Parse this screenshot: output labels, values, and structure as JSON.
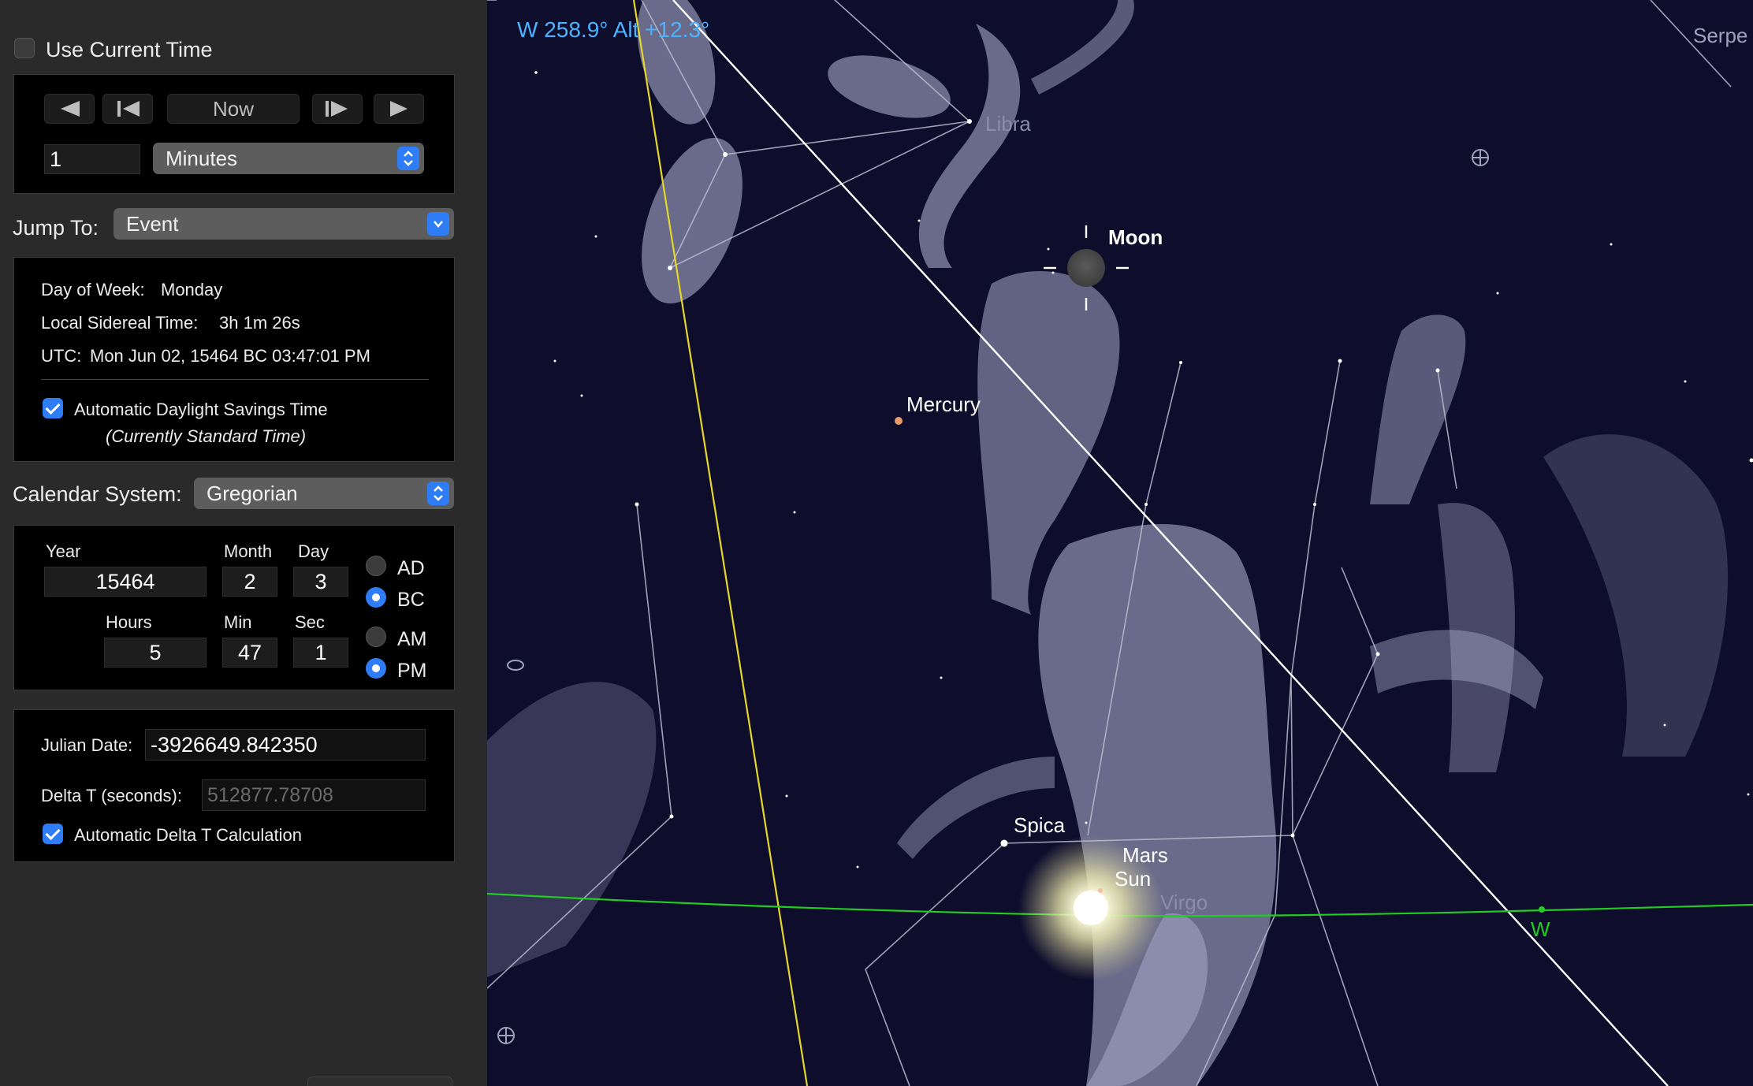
{
  "time_panel": {
    "use_current_time_label": "Use Current Time",
    "use_current_time_checked": false,
    "step_controls": {
      "rewind_icon": "rewind-icon",
      "step_back_icon": "step-back-icon",
      "now_label": "Now",
      "step_forward_icon": "step-forward-icon",
      "play_icon": "play-icon"
    },
    "step_amount": "1",
    "step_unit": "Minutes",
    "jump_to_label": "Jump To:",
    "jump_to_value": "Event"
  },
  "info": {
    "day_of_week_label": "Day of Week:",
    "day_of_week": "Monday",
    "sidereal_label": "Local Sidereal Time:",
    "sidereal_time": "3h 1m 26s",
    "utc_label": "UTC:",
    "utc_value": "Mon Jun 02, 15464 BC 03:47:01 PM",
    "dst_label": "Automatic Daylight Savings Time",
    "dst_checked": true,
    "dst_note": "(Currently Standard Time)"
  },
  "calendar": {
    "label": "Calendar System:",
    "value": "Gregorian",
    "year_label": "Year",
    "year": "15464",
    "month_label": "Month",
    "month": "2",
    "day_label": "Day",
    "day": "3",
    "hours_label": "Hours",
    "hours": "5",
    "min_label": "Min",
    "min": "47",
    "sec_label": "Sec",
    "sec": "1",
    "era_options": [
      "AD",
      "BC"
    ],
    "era_selected": "BC",
    "meridiem_options": [
      "AM",
      "PM"
    ],
    "meridiem_selected": "PM"
  },
  "julian": {
    "julian_label": "Julian Date:",
    "julian_value": "-3926649.842350",
    "delta_label": "Delta T (seconds):",
    "delta_value": "512877.78708",
    "auto_delta_label": "Automatic Delta T Calculation",
    "auto_delta_checked": true
  },
  "sky": {
    "pointer_readout": "W 258.9° Alt +12.3°",
    "labels": {
      "libra": "Libra",
      "virgo": "Virgo",
      "serpens": "Serpe",
      "moon": "Moon",
      "mercury": "Mercury",
      "spica": "Spica",
      "mars": "Mars",
      "sun": "Sun",
      "west_marker": "W"
    },
    "colors": {
      "background": "#0e0d2c",
      "readout": "#4db3ff",
      "ecliptic": "#e6d62a",
      "horizon": "#22cc22",
      "artwork": "#b6b9d8"
    }
  }
}
